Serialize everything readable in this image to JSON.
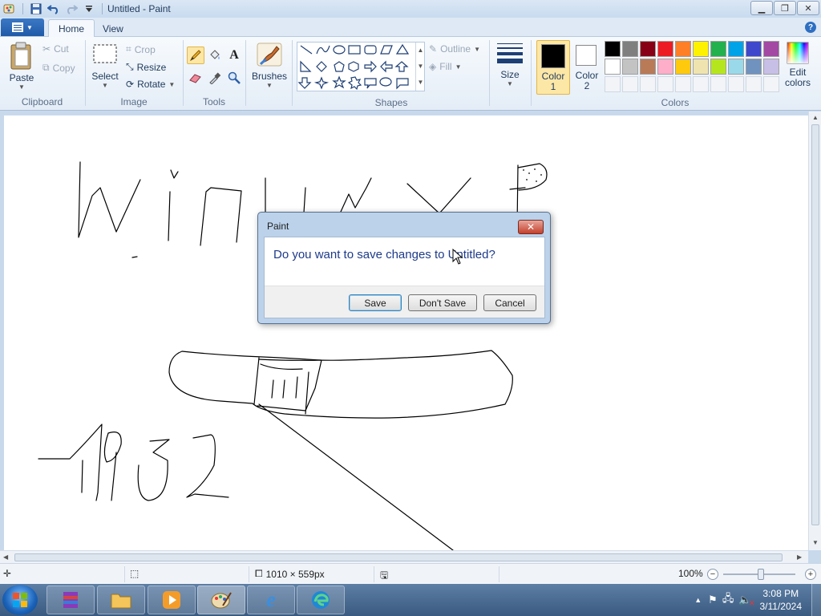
{
  "window": {
    "title": "Untitled - Paint"
  },
  "tabs": [
    {
      "label": "Home",
      "active": true
    },
    {
      "label": "View",
      "active": false
    }
  ],
  "ribbon": {
    "clipboard": {
      "group_label": "Clipboard",
      "paste": "Paste",
      "cut": "Cut",
      "copy": "Copy"
    },
    "image": {
      "group_label": "Image",
      "select": "Select",
      "crop": "Crop",
      "resize": "Resize",
      "rotate": "Rotate"
    },
    "tools": {
      "group_label": "Tools",
      "selected": "pencil"
    },
    "brushes": {
      "label": "Brushes"
    },
    "shapes": {
      "group_label": "Shapes",
      "outline": "Outline",
      "fill": "Fill"
    },
    "size": {
      "label": "Size"
    },
    "colors": {
      "group_label": "Colors",
      "color1_label": "Color",
      "color1_num": "1",
      "color2_label": "Color",
      "color2_num": "2",
      "edit_label": "Edit",
      "edit_label2": "colors",
      "color1": "#000000",
      "color2": "#ffffff",
      "palette_row1": [
        "#000000",
        "#7f7f7f",
        "#880015",
        "#ed1c24",
        "#ff7f27",
        "#fff200",
        "#22b14c",
        "#00a2e8",
        "#3f48cc",
        "#a349a4"
      ],
      "palette_row2": [
        "#ffffff",
        "#c3c3c3",
        "#b97a57",
        "#ffaec9",
        "#ffc90e",
        "#efe4b0",
        "#b5e61d",
        "#99d9ea",
        "#7092be",
        "#c8bfe7"
      ],
      "palette_row3": [
        "#f2f4f8",
        "#f2f4f8",
        "#f2f4f8",
        "#f2f4f8",
        "#f2f4f8",
        "#f2f4f8",
        "#f2f4f8",
        "#f2f4f8",
        "#f2f4f8",
        "#f2f4f8"
      ]
    }
  },
  "dialog": {
    "title": "Paint",
    "message": "Do you want to save changes to Untitled?",
    "save": "Save",
    "dont_save": "Don't Save",
    "cancel": "Cancel"
  },
  "statusbar": {
    "dimensions": "1010 × 559px",
    "zoom": "100%"
  },
  "taskbar": {
    "time": "3:08 PM",
    "date": "3/11/2024"
  }
}
